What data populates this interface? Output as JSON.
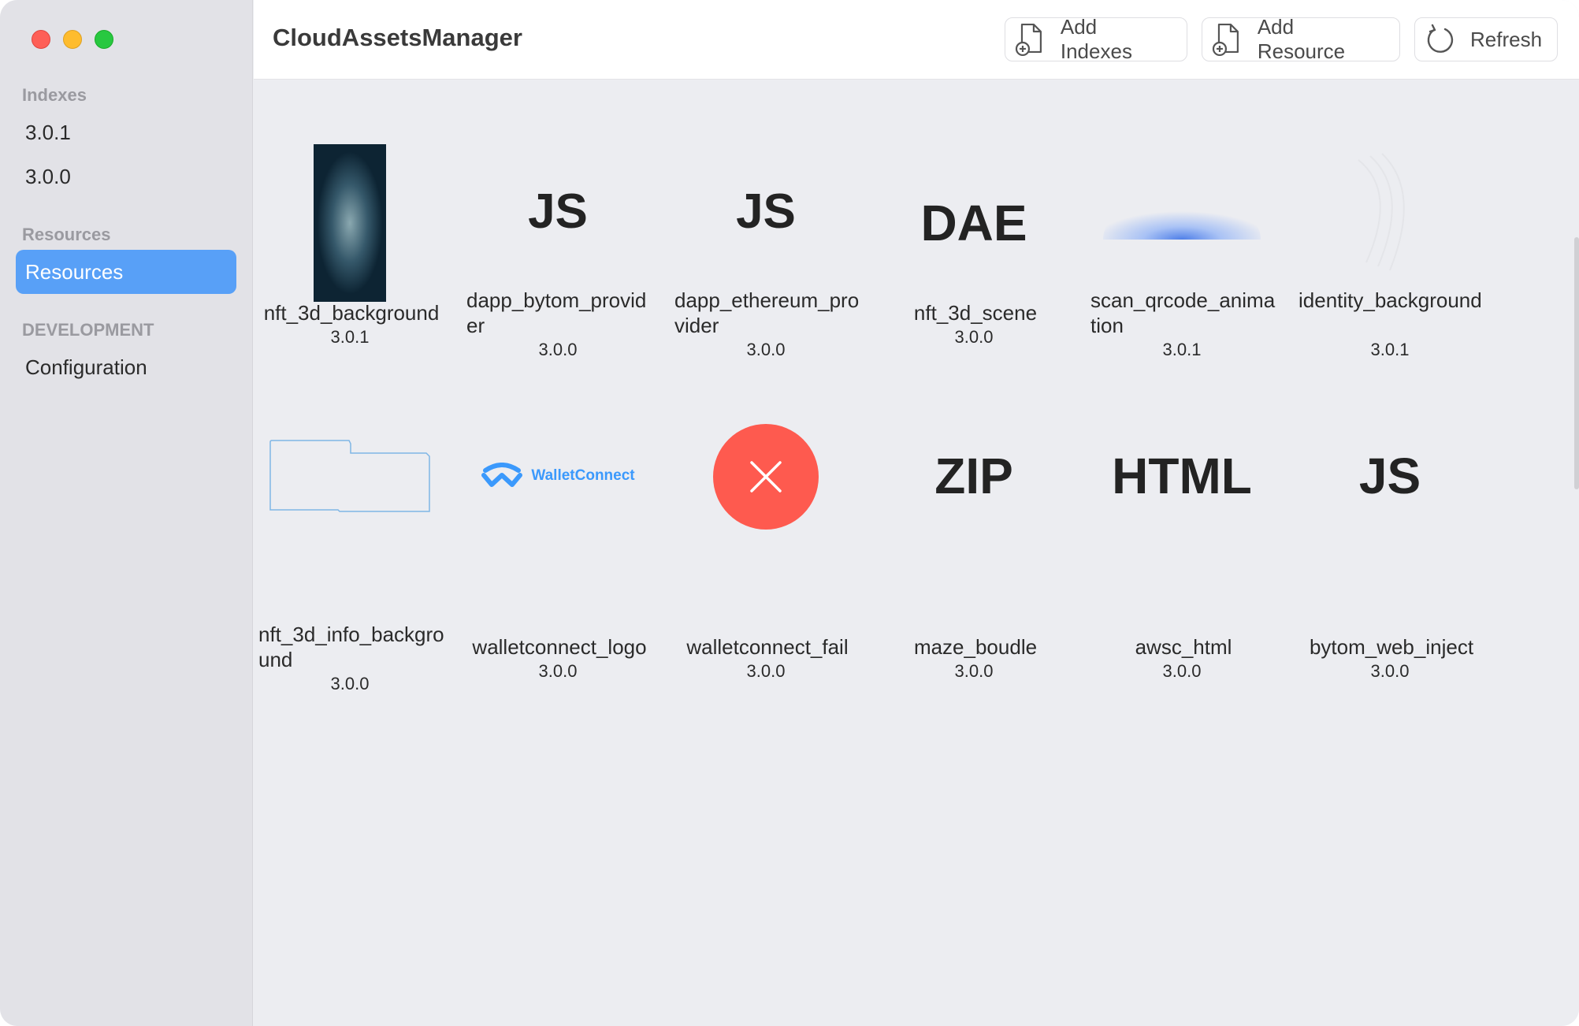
{
  "window": {
    "title": "CloudAssetsManager"
  },
  "toolbar": {
    "add_indexes": "Add Indexes",
    "add_resource": "Add Resource",
    "refresh": "Refresh"
  },
  "sidebar": {
    "sections": [
      {
        "label": "Indexes",
        "items": [
          {
            "label": "3.0.1"
          },
          {
            "label": "3.0.0"
          }
        ]
      },
      {
        "label": "Resources",
        "items": [
          {
            "label": "Resources",
            "selected": true
          }
        ]
      },
      {
        "label": "DEVELOPMENT",
        "items": [
          {
            "label": "Configuration"
          }
        ]
      }
    ]
  },
  "colors": {
    "accent": "#58a0f7",
    "fail_red": "#fe5a4f",
    "walletconnect_blue": "#3b99fc"
  },
  "resources": [
    {
      "name": "nft_3d_background",
      "version": "3.0.1",
      "thumb": "image"
    },
    {
      "name": "dapp_bytom_provider",
      "version": "3.0.0",
      "thumb": "JS"
    },
    {
      "name": "dapp_ethereum_provider",
      "version": "3.0.0",
      "thumb": "JS"
    },
    {
      "name": "nft_3d_scene",
      "version": "3.0.0",
      "thumb": "DAE"
    },
    {
      "name": "scan_qrcode_animation",
      "version": "3.0.1",
      "thumb": "image"
    },
    {
      "name": "identity_background",
      "version": "3.0.1",
      "thumb": "image"
    },
    {
      "name": "nft_3d_info_background",
      "version": "3.0.0",
      "thumb": "image"
    },
    {
      "name": "walletconnect_logo",
      "version": "3.0.0",
      "thumb": "WalletConnect"
    },
    {
      "name": "walletconnect_fail",
      "version": "3.0.0",
      "thumb": "fail-icon"
    },
    {
      "name": "maze_boudle",
      "version": "3.0.0",
      "thumb": "ZIP"
    },
    {
      "name": "awsc_html",
      "version": "3.0.0",
      "thumb": "HTML"
    },
    {
      "name": "bytom_web_inject",
      "version": "3.0.0",
      "thumb": "JS"
    }
  ]
}
